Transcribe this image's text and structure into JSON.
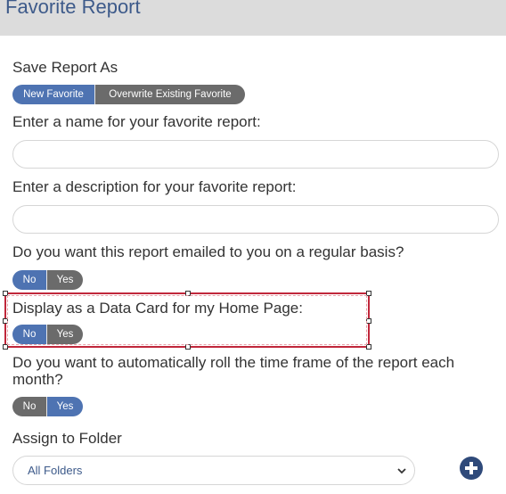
{
  "header": {
    "title": "Favorite Report"
  },
  "save_as": {
    "label": "Save Report As",
    "options": [
      "New Favorite",
      "Overwrite Existing Favorite"
    ],
    "selected": "New Favorite"
  },
  "name_field": {
    "label": "Enter a name for your favorite report:",
    "value": ""
  },
  "description_field": {
    "label": "Enter a description for your favorite report:",
    "value": ""
  },
  "email": {
    "label": "Do you want this report emailed to you on a regular basis?",
    "no_label": "No",
    "yes_label": "Yes",
    "selected": "No"
  },
  "data_card": {
    "label": "Display as a Data Card for my Home Page:",
    "no_label": "No",
    "yes_label": "Yes",
    "selected": "No"
  },
  "roll_timeframe": {
    "label": "Do you want to automatically roll the time frame of the report each month?",
    "no_label": "No",
    "yes_label": "Yes",
    "selected": "Yes"
  },
  "folder": {
    "label": "Assign to Folder",
    "selected": "All Folders",
    "add_icon": "plus-circle-icon"
  },
  "colors": {
    "accent": "#4e73b2",
    "inactive": "#6b6b6b",
    "highlight": "#c0273b"
  }
}
